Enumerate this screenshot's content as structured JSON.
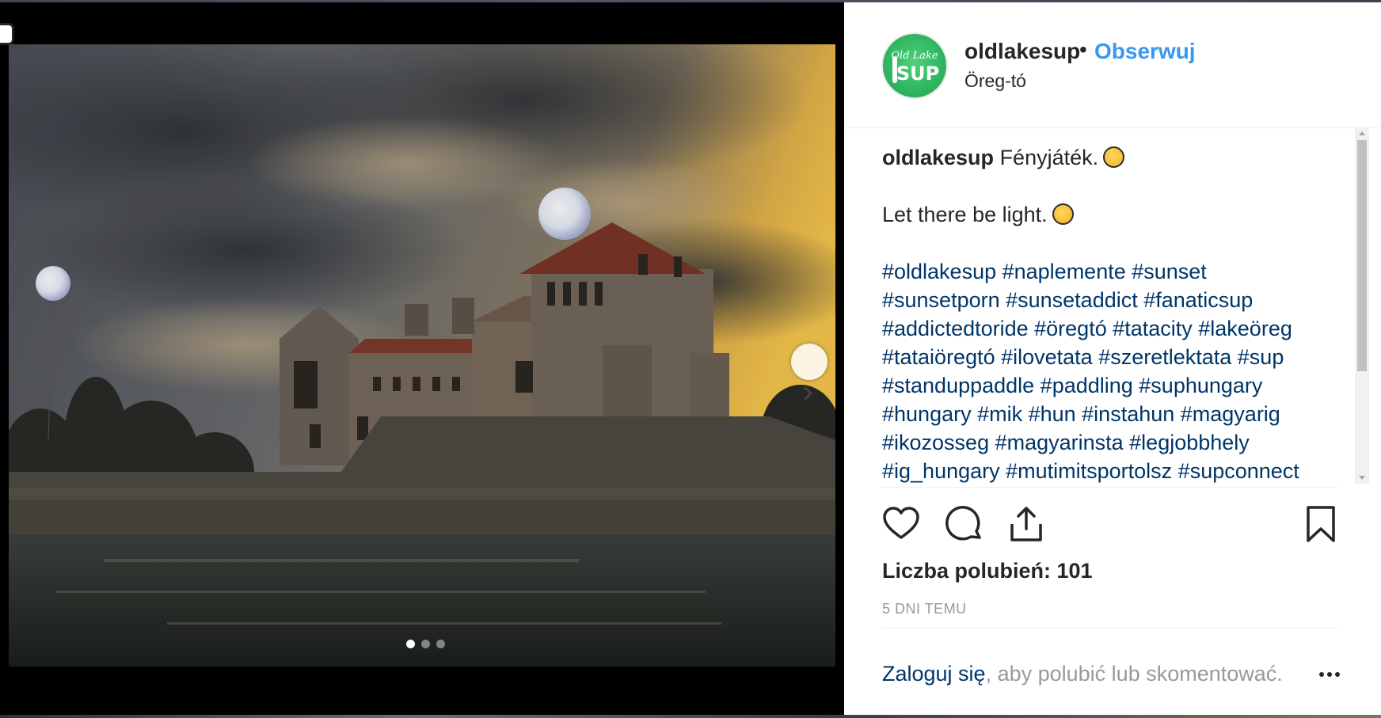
{
  "post": {
    "username": "oldlakesup",
    "separator": "•",
    "follow_label": "Obserwuj",
    "location": "Öreg-tó",
    "avatar_text_top": "Old Lake",
    "avatar_text_main": "SUP"
  },
  "caption": {
    "username": "oldlakesup",
    "line1": "Fényjáték.",
    "line2": "Let there be light.",
    "hashtag_lines": [
      "#oldlakesup #naplemente #sunset",
      "#sunsetporn #sunsetaddict #fanaticsup",
      "#addictedtoride #öregtó #tatacity #lakeöreg",
      "#tataiöregtó #ilovetata #szeretlektata #sup",
      "#standuppaddle #paddling #suphungary",
      "#hungary #mik #hun #instahun #magyarig",
      "#ikozosseg #magyarinsta #legjobbhely",
      "#ig_hungary #mutimitsportolsz #supconnect"
    ]
  },
  "actions": {
    "like_icon": "heart-icon",
    "comment_icon": "comment-icon",
    "share_icon": "share-icon",
    "save_icon": "bookmark-icon"
  },
  "stats": {
    "likes_text": "Liczba polubień: 101",
    "time_ago": "5 DNI TEMU"
  },
  "footer": {
    "login_link": "Zaloguj się",
    "login_rest": ", aby polubić lub skomentować."
  },
  "carousel": {
    "slide_count": 3,
    "active_index": 0,
    "next_icon": "chevron-right-icon"
  },
  "colors": {
    "link_blue": "#3897f0",
    "hashtag_blue": "#003569",
    "text": "#262626",
    "muted": "#999999",
    "brand_green": "#2fb55f"
  }
}
